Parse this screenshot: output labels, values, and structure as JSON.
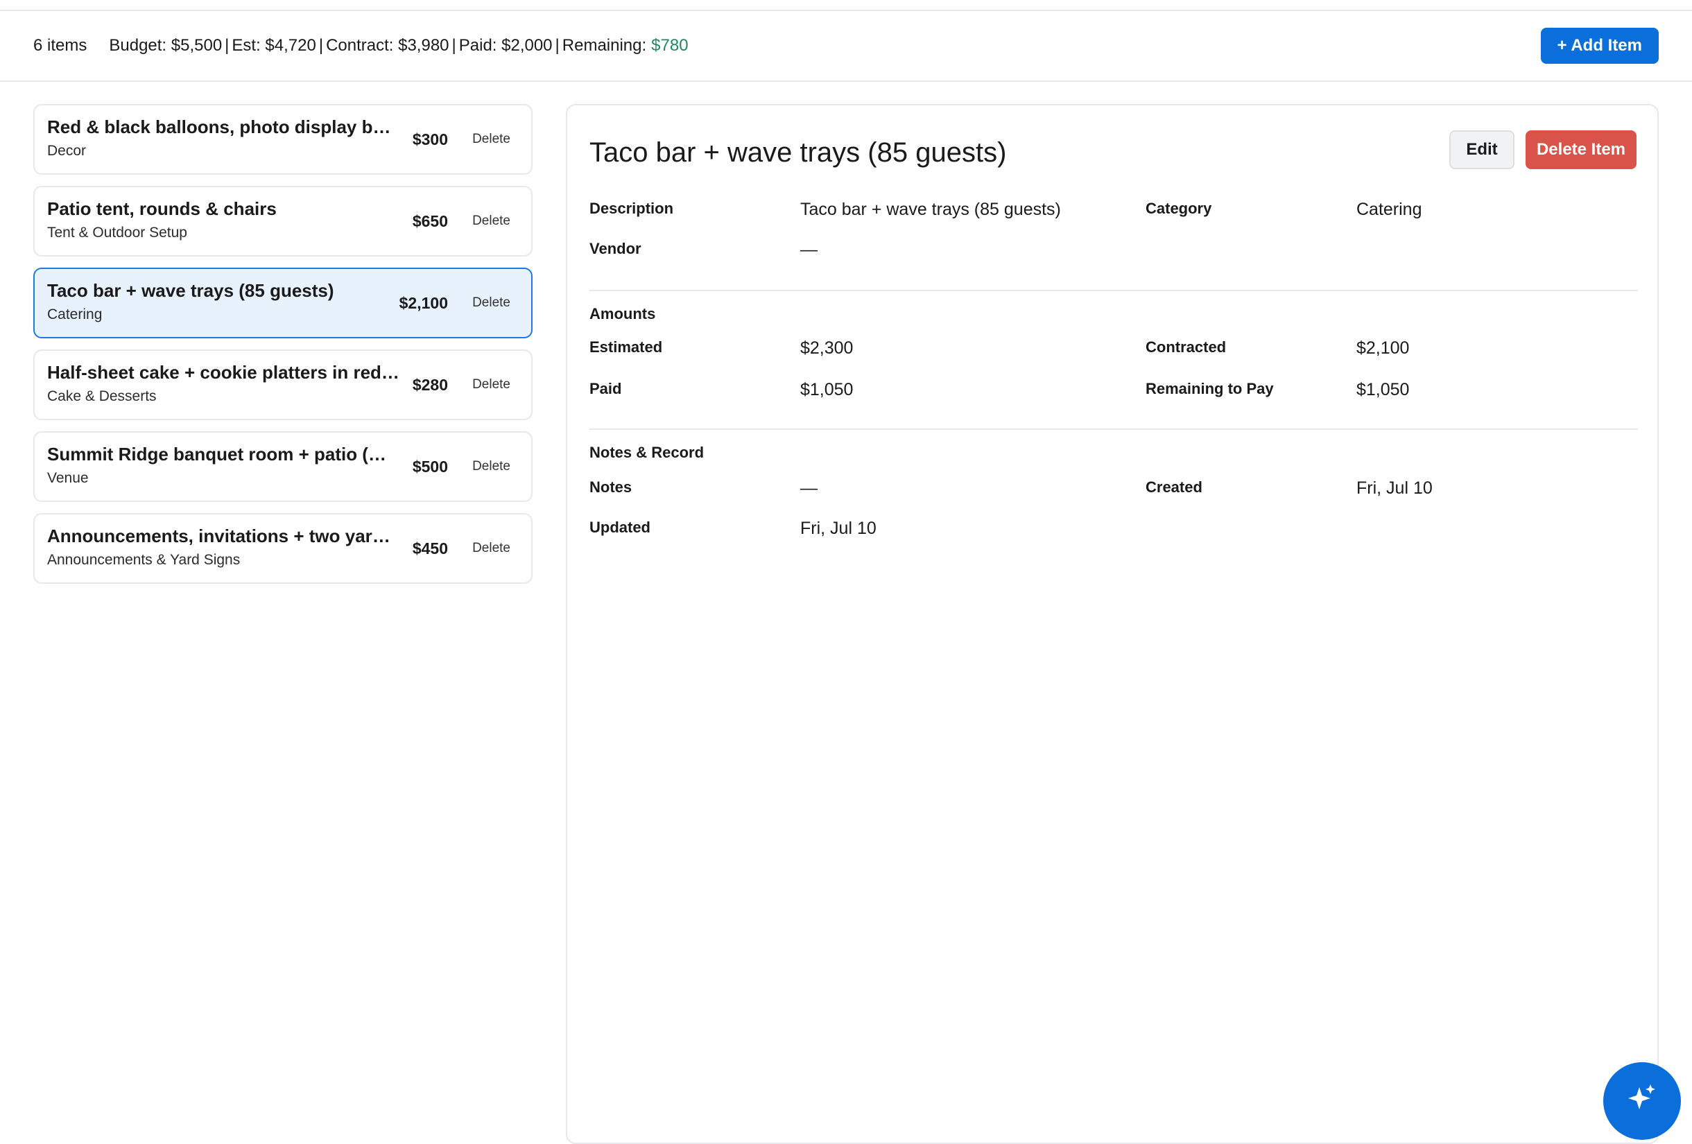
{
  "summary": {
    "count": "6 items",
    "budget": "Budget: $5,500",
    "estimated": "Est: $4,720",
    "contract": "Contract: $3,980",
    "paid": "Paid: $2,000",
    "remaining_label": "Remaining:",
    "remaining_value": "$780",
    "separator": "|"
  },
  "actions": {
    "add_item": "+ Add Item"
  },
  "items": [
    {
      "title": "Red & black balloons, photo display boar...",
      "category": "Decor",
      "price": "$300",
      "delete": "Delete"
    },
    {
      "title": "Patio tent, rounds & chairs",
      "category": "Tent & Outdoor Setup",
      "price": "$650",
      "delete": "Delete"
    },
    {
      "title": "Taco bar + wave trays (85 guests)",
      "category": "Catering",
      "price": "$2,100",
      "delete": "Delete"
    },
    {
      "title": "Half-sheet cake + cookie platters in red &...",
      "category": "Cake & Desserts",
      "price": "$280",
      "delete": "Delete"
    },
    {
      "title": "Summit Ridge banquet room + patio (me...",
      "category": "Venue",
      "price": "$500",
      "delete": "Delete"
    },
    {
      "title": "Announcements, invitations + two yard si...",
      "category": "Announcements & Yard Signs",
      "price": "$450",
      "delete": "Delete"
    }
  ],
  "detail": {
    "title": "Taco bar + wave trays (85 guests)",
    "edit": "Edit",
    "delete_item": "Delete Item",
    "description_label": "Description",
    "description_value": "Taco bar + wave trays (85 guests)",
    "category_label": "Category",
    "category_value": "Catering",
    "vendor_label": "Vendor",
    "vendor_value": "—",
    "amounts_heading": "Amounts",
    "estimated_label": "Estimated",
    "estimated_value": "$2,300",
    "contracted_label": "Contracted",
    "contracted_value": "$2,100",
    "paid_label": "Paid",
    "paid_value": "$1,050",
    "remaining_label": "Remaining to Pay",
    "remaining_value": "$1,050",
    "notes_heading": "Notes & Record",
    "notes_label": "Notes",
    "notes_value": "—",
    "created_label": "Created",
    "created_value": "Fri, Jul 10",
    "updated_label": "Updated",
    "updated_value": "Fri, Jul 10"
  },
  "colors": {
    "accent": "#0b6fdb",
    "danger": "#d9534a",
    "positive": "#1f8a5b",
    "selected_bg": "#e8f2fc"
  },
  "icons": {
    "fab": "sparkle-icon"
  }
}
